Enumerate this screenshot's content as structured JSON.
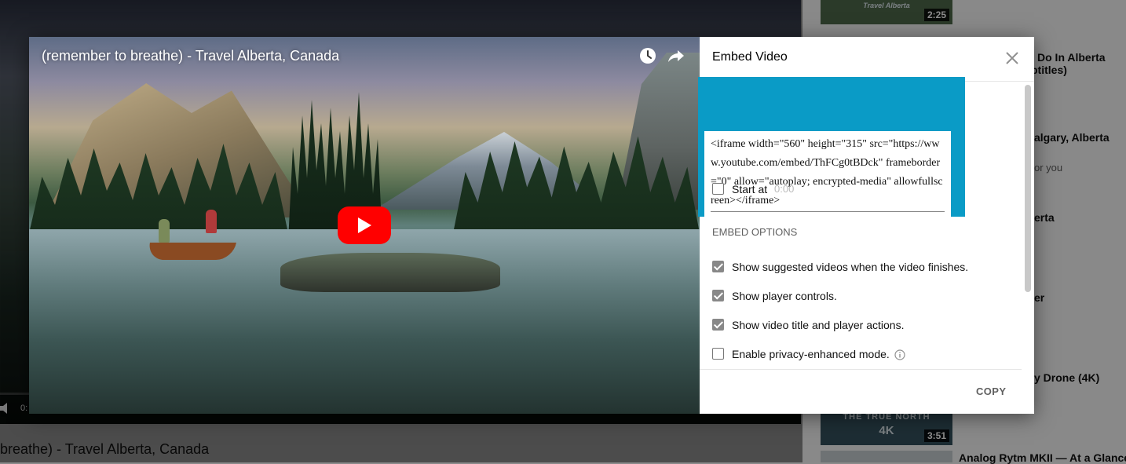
{
  "background": {
    "video_title_partial": "breathe) - Travel Alberta, Canada",
    "time_partial": "0:",
    "sidebar": [
      {
        "thumb_duration": "2:25",
        "thumb_text": "Travel Alberta"
      },
      {
        "text": "Do In Alberta"
      },
      {
        "text": "btitles)"
      },
      {
        "text": "algary, Alberta"
      },
      {
        "sub": "or you"
      },
      {
        "text": "erta"
      },
      {
        "text": "er"
      },
      {
        "text": "y Drone (4K)"
      },
      {
        "thumb_duration": "3:51",
        "thumb_text_1": "THE TRUE NORTH",
        "thumb_text_2": "4K"
      },
      {
        "text": "Analog Rytm MKII — At a Glance"
      }
    ]
  },
  "video": {
    "title": "(remember to breathe) - Travel Alberta, Canada",
    "icons": [
      "watch-later-icon",
      "share-icon",
      "play-icon"
    ]
  },
  "embed": {
    "title": "Embed Video",
    "code": "<iframe width=\"560\" height=\"315\" src=\"https://www.youtube.com/embed/ThFCg0tBDck\" frameborder=\"0\" allow=\"autoplay; encrypted-media\" allowfullscreen></iframe>",
    "start_at": {
      "label": "Start at",
      "placeholder": "0:00",
      "checked": false
    },
    "options_heading": "EMBED OPTIONS",
    "options": [
      {
        "label": "Show suggested videos when the video finishes.",
        "checked": true
      },
      {
        "label": "Show player controls.",
        "checked": true
      },
      {
        "label": "Show video title and player actions.",
        "checked": true
      },
      {
        "label": "Enable privacy-enhanced mode.",
        "checked": false
      }
    ],
    "copy_label": "COPY"
  },
  "colors": {
    "highlight": "#0a9bc6",
    "play_red": "#ff0000",
    "checkbox_checked": "#888888"
  }
}
